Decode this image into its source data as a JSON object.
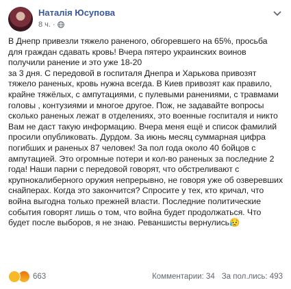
{
  "post": {
    "author": "Наталія Юсупова",
    "time": "8 ч.",
    "paragraphs": [
      "В Днепр привезли тяжело раненого, обгоревшего на 65%, просьба для граждан сдавать кровь! Вчера пятеро украинских воинов получили ранение и это уже 18-20",
      "за 3 дня. С передовой в госпиталя Днепра и Харькова привозят тяжело раненых, кровь нужна всегда. В Киев привозят как правило, крайне тяжёлых, с ампутациями, с пулевыми ранениями, с травмами головы , контузиями и многое другое. Пож, не задавайте вопросы сколько раненых лежат в отделениях, это военные госпиталя и никто Вам не даст такую информацию. Вчера меня ещё и список фамилий просили опубликовать. Дурдом. За июнь месяц суммарная цифра погибших и раненых 87 человек! За пол года около 40 бойцов с ампутацией. Это огромные потери и кол-во раненых за последние 2 года! Наши парни с передовой говорят, что обстреливают с крупнокалиберного оружия непрерывно, не говоря уже об озверевших снайперах. Когда это закончится? Спросите у тех, кто кричал, что война выгодна только прежней власти. Последние политические события говорят лишь о том, что война будет продолжаться. Что будет после выборов, я не знаю. Реваншисты вернулись😥"
    ]
  },
  "footer": {
    "reaction_count": "663",
    "comments": "Комментарии: 34",
    "shares": "За пол.лись: 493"
  }
}
